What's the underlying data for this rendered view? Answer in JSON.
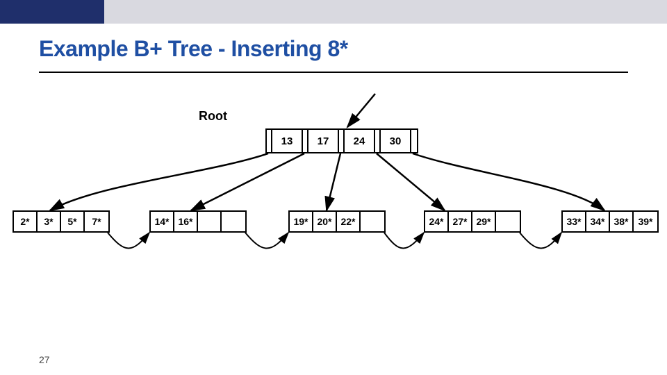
{
  "slide": {
    "title": "Example B+ Tree - Inserting 8*",
    "page_number": "27"
  },
  "tree": {
    "root_label": "Root",
    "root_keys": [
      "13",
      "17",
      "24",
      "30"
    ],
    "leaves": [
      {
        "cells": [
          "2*",
          "3*",
          "5*",
          "7*"
        ]
      },
      {
        "cells": [
          "14*",
          "16*",
          "",
          ""
        ]
      },
      {
        "cells": [
          "19*",
          "20*",
          "22*",
          ""
        ]
      },
      {
        "cells": [
          "24*",
          "27*",
          "29*",
          ""
        ]
      },
      {
        "cells": [
          "33*",
          "34*",
          "38*",
          "39*"
        ]
      }
    ]
  }
}
